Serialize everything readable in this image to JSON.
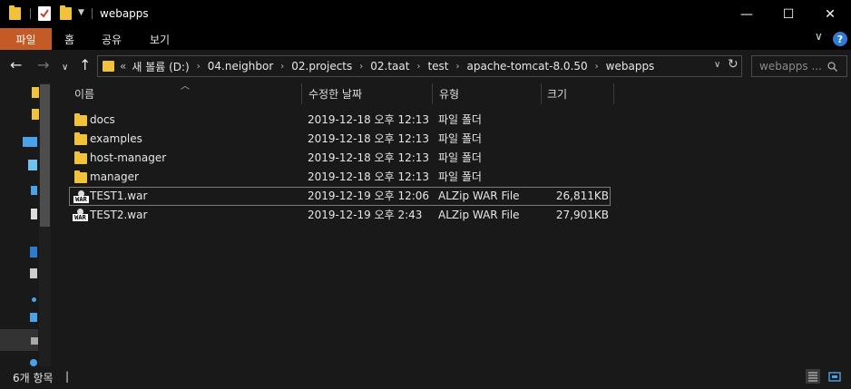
{
  "window": {
    "title": "webapps",
    "minimize": "—",
    "maximize": "☐",
    "close": "✕"
  },
  "ribbon": {
    "tabs": [
      "파일",
      "홈",
      "공유",
      "보기"
    ],
    "help": "?",
    "collapse": "∨"
  },
  "nav": {
    "back": "←",
    "forward": "→",
    "recent": "∨",
    "up": "↑",
    "overflow": "«",
    "breadcrumbs": [
      "새 볼륨 (D:)",
      "04.neighbor",
      "02.projects",
      "02.taat",
      "test",
      "apache-tomcat-8.0.50",
      "webapps"
    ],
    "crumb_sep": "›",
    "dropdown": "∨",
    "refresh": "↻",
    "search_placeholder": "webapps ..."
  },
  "columns": {
    "name": "이름",
    "modified": "수정한 날짜",
    "type": "유형",
    "size": "크기"
  },
  "files": [
    {
      "name": "docs",
      "modified": "2019-12-18 오후 12:13",
      "type": "파일 폴더",
      "size": "",
      "icon": "folder-icon"
    },
    {
      "name": "examples",
      "modified": "2019-12-18 오후 12:13",
      "type": "파일 폴더",
      "size": "",
      "icon": "folder-icon"
    },
    {
      "name": "host-manager",
      "modified": "2019-12-18 오후 12:13",
      "type": "파일 폴더",
      "size": "",
      "icon": "folder-icon"
    },
    {
      "name": "manager",
      "modified": "2019-12-18 오후 12:13",
      "type": "파일 폴더",
      "size": "",
      "icon": "folder-icon"
    },
    {
      "name": "TEST1.war",
      "modified": "2019-12-19 오후 12:06",
      "type": "ALZip WAR File",
      "size": "26,811KB",
      "icon": "war-file-icon"
    },
    {
      "name": "TEST2.war",
      "modified": "2019-12-19 오후 2:43",
      "type": "ALZip WAR File",
      "size": "27,901KB",
      "icon": "war-file-icon"
    }
  ],
  "war_badge": "WAR",
  "status": {
    "count": "6개 항목",
    "caret": "|"
  },
  "colors": {
    "accent": "#c45a26",
    "folder": "#f3c23d",
    "background": "#191919",
    "titlebar": "#000000"
  }
}
